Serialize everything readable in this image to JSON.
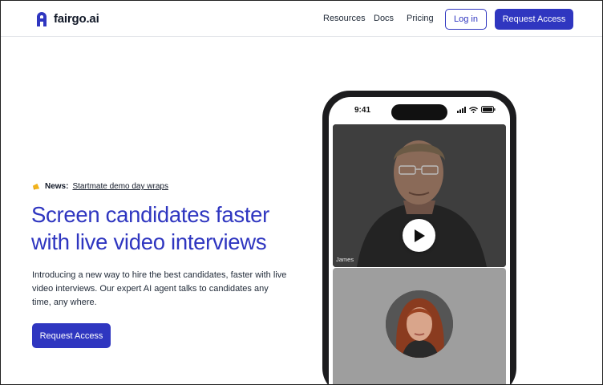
{
  "brand": {
    "name": "fairgo.ai"
  },
  "nav": {
    "resources": "Resources",
    "docs": "Docs",
    "pricing": "Pricing",
    "login": "Log in",
    "request_access": "Request Access"
  },
  "hero": {
    "news_label": "News:",
    "news_link": "Startmate demo day wraps",
    "headline": "Screen candidates faster with live video interviews",
    "subtext": "Introducing a new way to hire the best candidates, faster with live video interviews. Our expert AI agent talks to candidates any time, any where.",
    "cta": "Request Access"
  },
  "phone": {
    "time": "9:41",
    "participant_name": "James"
  },
  "colors": {
    "accent": "#2f36c0",
    "news_icon": "#f2b31b"
  }
}
